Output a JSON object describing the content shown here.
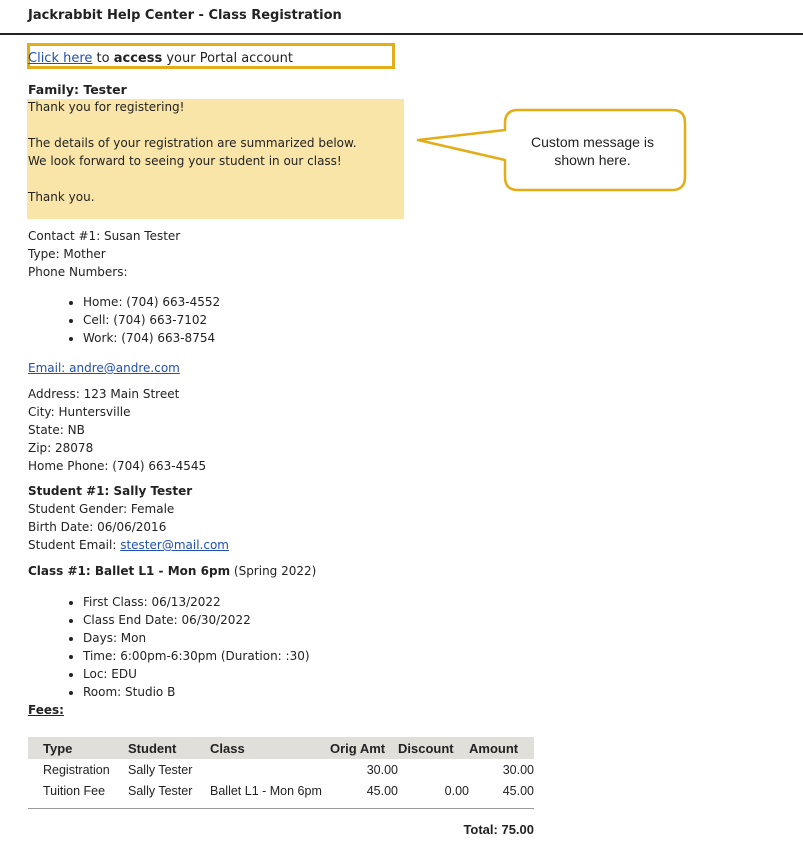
{
  "header": {
    "title": "Jackrabbit Help Center - Class Registration"
  },
  "portal": {
    "link_text": "Click here",
    "pre_bold": " to ",
    "bold_text": "access",
    "post_bold": " your Portal account"
  },
  "family": {
    "label": "Family: Tester"
  },
  "message": {
    "lines": [
      "Thank you for registering!",
      "",
      "The details of your registration are summarized below.",
      "We look forward to seeing your student in our class!",
      "",
      "Thank you."
    ]
  },
  "callout": {
    "line1": "Custom message is",
    "line2": "shown here.",
    "border_color": "#e3ad17"
  },
  "contact": {
    "name_line": "Contact #1: Susan Tester",
    "type_line": "Type: Mother",
    "phones_label": "Phone Numbers:",
    "phones": [
      "Home: (704) 663-4552",
      "Cell: (704) 663-7102",
      "Work: (704) 663-8754"
    ],
    "email_link": "Email: andre@andre.com"
  },
  "address": {
    "address": "Address: 123 Main Street",
    "city": "City: Huntersville",
    "state": "State: NB",
    "zip": "Zip: 28078",
    "home_phone": "Home Phone: (704) 663-4545"
  },
  "student": {
    "title": "Student #1: Sally Tester",
    "gender": "Student Gender: Female",
    "birth": "Birth Date: 06/06/2016",
    "email_label": "Student Email: ",
    "email": "stester@mail.com"
  },
  "class": {
    "title": "Class #1: Ballet L1 - Mon 6pm",
    "session": " (Spring 2022)",
    "details": [
      "First Class: 06/13/2022",
      "Class End Date: 06/30/2022",
      "Days: Mon",
      "Time: 6:00pm-6:30pm (Duration: :30)",
      "Loc: EDU",
      "Room: Studio B"
    ]
  },
  "fees": {
    "label": "Fees:",
    "headers": [
      "Type",
      "Student",
      "Class",
      "Orig Amt",
      "Discount",
      "Amount"
    ],
    "rows": [
      [
        "Registration",
        "Sally Tester",
        "",
        "30.00",
        "",
        "30.00"
      ],
      [
        "Tuition Fee",
        "Sally Tester",
        "Ballet L1 - Mon 6pm",
        "45.00",
        "0.00",
        "45.00"
      ]
    ],
    "total": "Total: 75.00"
  },
  "colors": {
    "highlight_border": "#e3ad17",
    "message_bg": "#fae5a8",
    "link": "#1f4fb5"
  }
}
